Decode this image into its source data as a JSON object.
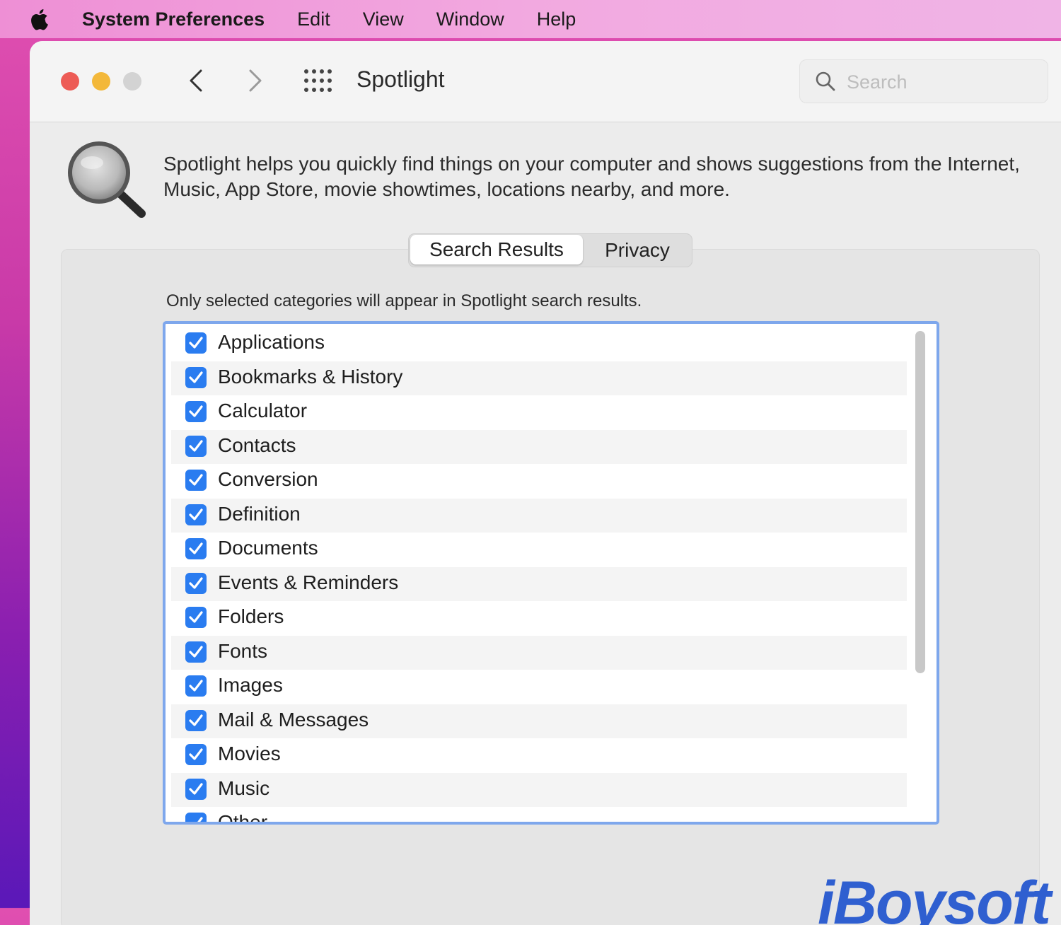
{
  "menubar": {
    "app_name": "System Preferences",
    "items": [
      "Edit",
      "View",
      "Window",
      "Help"
    ]
  },
  "window": {
    "title": "Spotlight",
    "search_placeholder": "Search"
  },
  "description": "Spotlight helps you quickly find things on your computer and shows suggestions from the Internet, Music, App Store, movie showtimes, locations nearby, and more.",
  "tabs": {
    "active": "Search Results",
    "inactive": "Privacy"
  },
  "hint": "Only selected categories will appear in Spotlight search results.",
  "categories": [
    {
      "label": "Applications",
      "checked": true
    },
    {
      "label": "Bookmarks & History",
      "checked": true
    },
    {
      "label": "Calculator",
      "checked": true
    },
    {
      "label": "Contacts",
      "checked": true
    },
    {
      "label": "Conversion",
      "checked": true
    },
    {
      "label": "Definition",
      "checked": true
    },
    {
      "label": "Documents",
      "checked": true
    },
    {
      "label": "Events & Reminders",
      "checked": true
    },
    {
      "label": "Folders",
      "checked": true
    },
    {
      "label": "Fonts",
      "checked": true
    },
    {
      "label": "Images",
      "checked": true
    },
    {
      "label": "Mail & Messages",
      "checked": true
    },
    {
      "label": "Movies",
      "checked": true
    },
    {
      "label": "Music",
      "checked": true
    },
    {
      "label": "Other",
      "checked": true
    }
  ],
  "watermark": "iBoysoft",
  "colors": {
    "accent": "#2a7cf0",
    "focus_ring": "#7ea7ec",
    "close": "#ed5b55",
    "minimize": "#f3b83a",
    "zoom_disabled": "#d3d3d3",
    "watermark": "#2f5fd0"
  },
  "icons": {
    "apple": "apple-logo-icon",
    "back": "chevron-left-icon",
    "forward": "chevron-right-icon",
    "grid": "show-all-grid-icon",
    "search": "magnifier-icon",
    "spotlight": "spotlight-magnifier-icon",
    "checkbox": "checkmark-icon"
  }
}
